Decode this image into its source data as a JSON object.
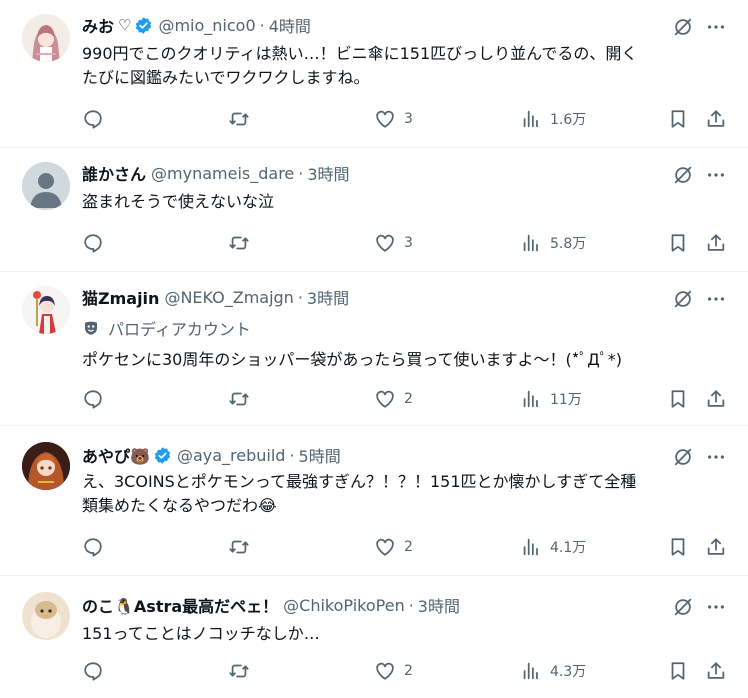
{
  "tweets": [
    {
      "name": "みお",
      "name_emoji": "♡",
      "verified": true,
      "handle": "@mio_nico0",
      "time": "4時間",
      "parody_label": "",
      "text_lines": [
        "990円でこのクオリティは熱い…！ビニ傘に151匹びっしり並んでるの、開く",
        "たびに図鑑みたいでワクワクしますね。"
      ],
      "likes": "3",
      "views": "1.6万"
    },
    {
      "name": "誰かさん",
      "name_emoji": "",
      "verified": false,
      "handle": "@mynameis_dare",
      "time": "3時間",
      "parody_label": "",
      "text_lines": [
        "盗まれそうで使えないな泣"
      ],
      "likes": "3",
      "views": "5.8万"
    },
    {
      "name": "猫Zmajin",
      "name_emoji": "",
      "verified": false,
      "handle": "@NEKO_Zmajgn",
      "time": "3時間",
      "parody_label": "パロディアカウント",
      "text_lines": [
        "ポケセンに30周年のショッパー袋があったら買って使いますよ〜！(*ﾟДﾟ*)"
      ],
      "likes": "2",
      "views": "11万"
    },
    {
      "name": "あやぴ🐻",
      "name_emoji": "",
      "verified": true,
      "handle": "@aya_rebuild",
      "time": "5時間",
      "parody_label": "",
      "text_lines": [
        "え、3COINSとポケモンって最強すぎん？！？！151匹とか懐かしすぎて全種",
        "類集めたくなるやつだわ😂"
      ],
      "likes": "2",
      "views": "4.1万"
    },
    {
      "name": "のこ🐧Astra最高だペェ！",
      "name_emoji": "",
      "verified": false,
      "handle": "@ChikoPikoPen",
      "time": "3時間",
      "parody_label": "",
      "text_lines": [
        "151ってことはノコッチなしか…"
      ],
      "likes": "2",
      "views": "4.3万"
    }
  ],
  "separator": "·",
  "icons": {
    "reply": "reply-icon",
    "retweet": "retweet-icon",
    "like": "heart-icon",
    "views": "views-icon",
    "bookmark": "bookmark-icon",
    "share": "share-icon",
    "grok": "grok-icon",
    "more": "more-icon",
    "verified": "verified-badge-icon",
    "parody": "parody-mask-icon"
  },
  "colors": {
    "text": "#0f1419",
    "secondary": "#536471",
    "verified_blue": "#1d9bf0",
    "divider": "#eff3f4"
  }
}
